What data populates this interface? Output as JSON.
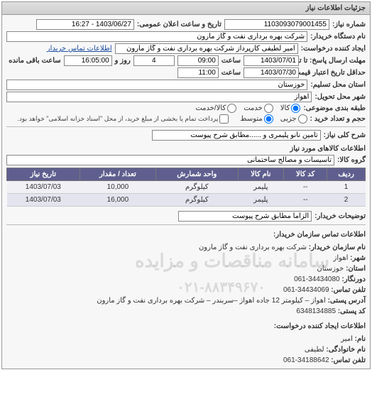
{
  "panel_title": "جزئیات اطلاعات نیاز",
  "fields": {
    "shomare_niaz_label": "شماره نیاز:",
    "shomare_niaz": "1103093079001455",
    "tarikh_elan_label": "تاریخ و ساعت اعلان عمومی:",
    "tarikh_elan": "1403/06/27 - 16:27",
    "nam_dastgah_label": "نام دستگاه خریدار:",
    "nam_dastgah": "شرکت بهره برداری نفت و گاز مارون",
    "ijadkonande_label": "ایجاد کننده درخواست:",
    "ijadkonande": "امیر لطیفی کارپرداز شرکت بهره برداری نفت و گاز مارون",
    "tamas_kharidar_link": "اطلاعات تماس خریدار",
    "mohlat_ta_label": "مهلت ارسال پاسخ: تا تاریخ:",
    "mohlat_ta_date": "1403/07/01",
    "saat_label": "ساعت",
    "mohlat_ta_time": "09:00",
    "rooz_label": "روز و",
    "rooz_val": "4",
    "saat_baghi_label": "ساعت باقی مانده",
    "saat_baghi_val": "16:05:00",
    "etebar_label": "حداقل تاریخ اعتبار قیمت: تا تاریخ:",
    "etebar_date": "1403/07/30",
    "etebar_time": "11:00",
    "ostan_label": "استان محل تسلیم:",
    "ostan": "خوزستان",
    "shahr_label": "شهر محل تحویل:",
    "shahr": "اهواز",
    "tabaghe_label": "طبقه بندی موضوعی:",
    "radio_kala": "کالا",
    "radio_khedmat": "خدمت",
    "radio_kala_khedmat": "کالا/خدمت",
    "hajm_label": "حجم و تعداد خرید :",
    "radio_jozee": "جزیی",
    "radio_motevaset": "متوسط",
    "check_note": "پرداخت تمام یا بخشی از مبلغ خرید، از محل \"اسناد خزانه اسلامی\" خواهد بود.",
    "sharh_koli_label": "شرح کلی نیاز:",
    "sharh_koli": "تامین نانو پلیمری و ......مطابق شرح پیوست",
    "etelaat_kalaha_title": "اطلاعات کالاهای مورد نیاز",
    "gorooh_label": "گروه کالا:",
    "gorooh": "تاسیسات و مصالح ساختمانی",
    "tozihat_label": "توضیحات خریدار:",
    "tozihat": "الزاما مطابق شرح پیوست",
    "tamas_sazman_title": "اطلاعات تماس سازمان خریدار:",
    "nam_sazman_label": "نام سازمان خریدار:",
    "nam_sazman": "شرکت بهره برداری نفت و گاز مارون",
    "shahr2_label": "شهر:",
    "shahr2": "اهواز",
    "ostan2_label": "استان:",
    "ostan2": "خوزستان",
    "dorfax_label": "دورنگار:",
    "dorfax": "34434080-061",
    "telefon_label": "تلفن تماس:",
    "telefon": "34434069-061",
    "adres_label": "آدرس پستی:",
    "adres": "اهواز – کیلومتر 12 جاده اهواز –سربندر – شرکت بهره برداری نفت و گاز مارون",
    "kodposti_label": "کد پستی:",
    "kodposti": "6348134885",
    "etelaat_ijad_title": "اطلاعات ایجاد کننده درخواست:",
    "nam_label": "نام:",
    "nam": "امیر",
    "famili_label": "نام خانوادگی:",
    "famili": "لطیفی",
    "telefon2_label": "تلفن تماس:",
    "telefon2": "34188642-061"
  },
  "table": {
    "headers": [
      "ردیف",
      "کد کالا",
      "نام کالا",
      "واحد شمارش",
      "تعداد / مقدار",
      "تاریخ نیاز"
    ],
    "rows": [
      {
        "r": "1",
        "code": "--",
        "name": "پلیمر",
        "unit": "کیلوگرم",
        "qty": "10,000",
        "date": "1403/07/03"
      },
      {
        "r": "2",
        "code": "--",
        "name": "پلیمر",
        "unit": "کیلوگرم",
        "qty": "16,000",
        "date": "1403/07/03"
      }
    ]
  },
  "watermark1": "سامانه مناقصات و مزایده",
  "watermark2": "۰۲۱-۸۸۳۴۹۶۷۰"
}
